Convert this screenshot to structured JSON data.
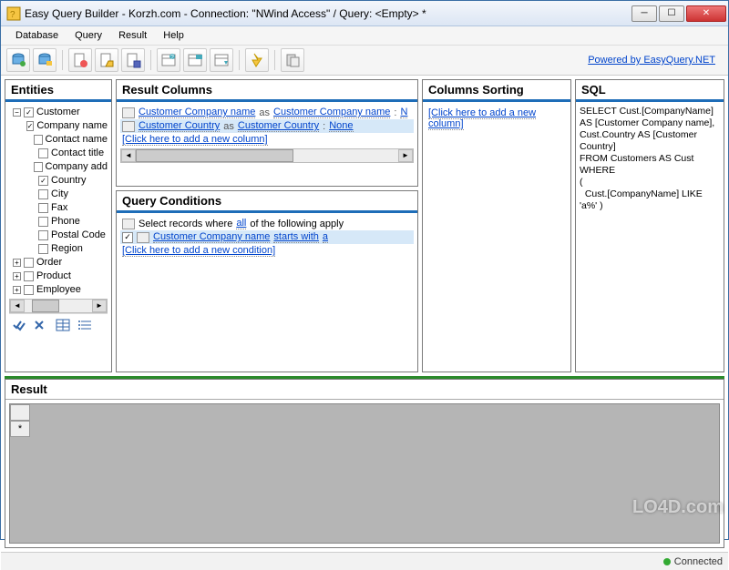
{
  "window": {
    "title": "Easy Query Builder - Korzh.com - Connection: \"NWind Access\" / Query: <Empty> *"
  },
  "menu": {
    "items": [
      "Database",
      "Query",
      "Result",
      "Help"
    ]
  },
  "toolbar": {
    "powered": "Powered by EasyQuery.NET"
  },
  "entities": {
    "title": "Entities",
    "tree": [
      {
        "level": 0,
        "expand": "minus",
        "checked": true,
        "label": "Customer"
      },
      {
        "level": 1,
        "checked": true,
        "label": "Company name"
      },
      {
        "level": 1,
        "checked": false,
        "label": "Contact name"
      },
      {
        "level": 1,
        "checked": false,
        "label": "Contact title"
      },
      {
        "level": 1,
        "checked": false,
        "label": "Company add"
      },
      {
        "level": 1,
        "checked": true,
        "label": "Country"
      },
      {
        "level": 1,
        "checked": false,
        "label": "City"
      },
      {
        "level": 1,
        "checked": false,
        "label": "Fax"
      },
      {
        "level": 1,
        "checked": false,
        "label": "Phone"
      },
      {
        "level": 1,
        "checked": false,
        "label": "Postal Code"
      },
      {
        "level": 1,
        "checked": false,
        "label": "Region"
      },
      {
        "level": 0,
        "expand": "plus",
        "checked": false,
        "label": "Order"
      },
      {
        "level": 0,
        "expand": "plus",
        "checked": false,
        "label": "Product"
      },
      {
        "level": 0,
        "expand": "plus",
        "checked": false,
        "label": "Employee"
      }
    ]
  },
  "columns": {
    "title": "Result Columns",
    "rows": [
      {
        "expr": "Customer Company name",
        "as": "as",
        "alias": "Customer Company name",
        "sort": "N",
        "sel": false
      },
      {
        "expr": "Customer Country",
        "as": "as",
        "alias": "Customer Country",
        "sort": "None",
        "sel": true
      }
    ],
    "add": "[Click here to add a new column]"
  },
  "conditions": {
    "title": "Query Conditions",
    "root_pre": "Select records where ",
    "root_link": "all",
    "root_post": " of the following apply",
    "rows": [
      {
        "attr": "Customer Company name",
        "op": "starts with",
        "val": "a",
        "checked": true
      }
    ],
    "add": "[Click here to add a new condition]"
  },
  "sorting": {
    "title": "Columns Sorting",
    "add": "[Click here to add a new column]"
  },
  "sql": {
    "title": "SQL",
    "text": "SELECT Cust.[CompanyName] AS [Customer Company name], Cust.Country AS [Customer Country]\nFROM Customers AS Cust\nWHERE\n(\n  Cust.[CompanyName] LIKE 'a%' )"
  },
  "result": {
    "title": "Result"
  },
  "status": {
    "label": "Connected"
  },
  "watermark": "LO4D.com"
}
